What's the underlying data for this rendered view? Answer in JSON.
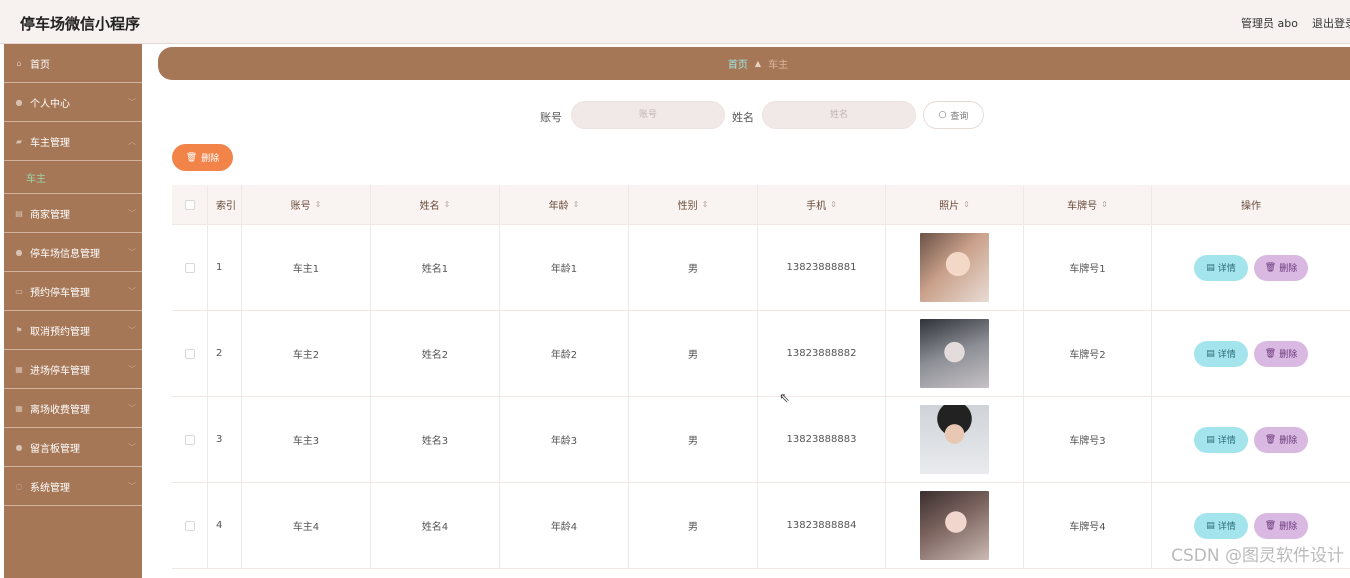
{
  "header": {
    "app_title": "停车场微信小程序",
    "admin": "管理员 abo",
    "logout": "退出登录"
  },
  "sidebar": {
    "items": [
      {
        "label": "首页",
        "icon": "home-icon"
      },
      {
        "label": "个人中心",
        "icon": "user-icon"
      },
      {
        "label": "车主管理",
        "icon": "car-icon"
      },
      {
        "label": "商家管理",
        "icon": "shop-icon"
      },
      {
        "label": "停车场信息管理",
        "icon": "user-icon"
      },
      {
        "label": "预约停车管理",
        "icon": "card-icon"
      },
      {
        "label": "取消预约管理",
        "icon": "flag-icon"
      },
      {
        "label": "进场停车管理",
        "icon": "building-icon"
      },
      {
        "label": "离场收费管理",
        "icon": "grid-icon"
      },
      {
        "label": "留言板管理",
        "icon": "user-icon"
      },
      {
        "label": "系统管理",
        "icon": "settings-icon"
      }
    ],
    "active_sub": "车主"
  },
  "breadcrumb": {
    "home": "首页",
    "current": "车主"
  },
  "search": {
    "account_label": "账号",
    "account_placeholder": "账号",
    "name_label": "姓名",
    "name_placeholder": "姓名",
    "query_label": "查询"
  },
  "toolbar": {
    "delete_label": "删除"
  },
  "table": {
    "headers": {
      "index": "索引",
      "account": "账号",
      "name": "姓名",
      "age": "年龄",
      "gender": "性别",
      "phone": "手机",
      "photo": "照片",
      "plate": "车牌号",
      "action": "操作"
    },
    "rows": [
      {
        "index": "1",
        "account": "车主1",
        "name": "姓名1",
        "age": "年龄1",
        "gender": "男",
        "phone": "13823888881",
        "plate": "车牌号1",
        "detail": "详情",
        "delete": "删除"
      },
      {
        "index": "2",
        "account": "车主2",
        "name": "姓名2",
        "age": "年龄2",
        "gender": "男",
        "phone": "13823888882",
        "plate": "车牌号2",
        "detail": "详情",
        "delete": "删除"
      },
      {
        "index": "3",
        "account": "车主3",
        "name": "姓名3",
        "age": "年龄3",
        "gender": "男",
        "phone": "13823888883",
        "plate": "车牌号3",
        "detail": "详情",
        "delete": "删除"
      },
      {
        "index": "4",
        "account": "车主4",
        "name": "姓名4",
        "age": "年龄4",
        "gender": "男",
        "phone": "13823888884",
        "plate": "车牌号4",
        "detail": "详情",
        "delete": "删除"
      }
    ]
  },
  "watermark": "CSDN @图灵软件设计",
  "colors": {
    "sidebar": "#a67756",
    "accent_delete": "#f2844a",
    "detail_btn": "#a4e4ec",
    "delete_btn": "#d9b8e2"
  }
}
